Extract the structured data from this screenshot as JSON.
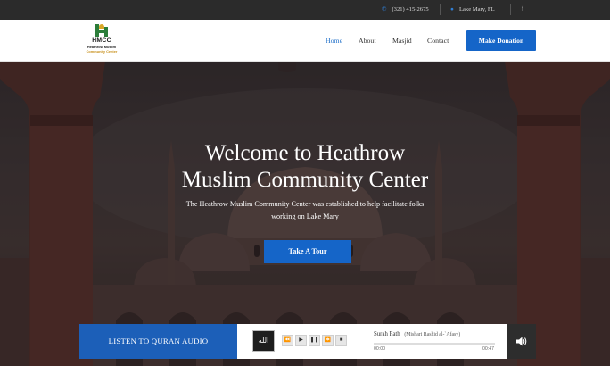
{
  "topbar": {
    "phone": "(321) 415-2675",
    "location": "Lake Mary, FL",
    "facebook": "f"
  },
  "logo": {
    "acronym": "HMCC",
    "line1": "Heathrow Muslim",
    "line2": "Community Center"
  },
  "nav": {
    "items": [
      {
        "label": "Home",
        "active": true
      },
      {
        "label": "About"
      },
      {
        "label": "Masjid"
      },
      {
        "label": "Contact"
      }
    ],
    "donate_label": "Make Donation"
  },
  "hero": {
    "title_line1": "Welcome to Heathrow",
    "title_line2": "Muslim Community Center",
    "subtitle_line1": "The Heathrow Muslim Community Center was established to help facilitate folks",
    "subtitle_line2": "working on Lake Mary",
    "cta_label": "Take A Tour"
  },
  "audio": {
    "label": "LISTEN TO QURAN AUDIO",
    "track_title": "Surah Fath",
    "track_artist": "(Mishari Rashid al-`Afasy)",
    "current_time": "00:00",
    "duration": "00:47",
    "progress": 0,
    "controls": [
      "rewind-icon",
      "play-icon",
      "pause-icon",
      "fast-forward-icon",
      "stop-icon"
    ]
  },
  "colors": {
    "accent": "#1565c8",
    "topbar": "#2b2b2b",
    "audio_label": "#1c5fb8",
    "volume_bg": "#2d2d2d"
  }
}
